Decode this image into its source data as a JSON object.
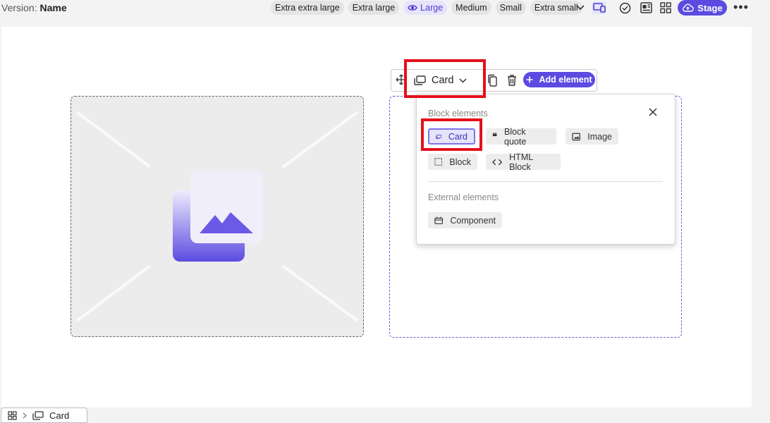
{
  "header": {
    "version_label": "Version:",
    "version_name": "Name",
    "sizes": [
      {
        "label": "Extra extra large",
        "active": false
      },
      {
        "label": "Extra large",
        "active": false
      },
      {
        "label": "Large",
        "active": true
      },
      {
        "label": "Medium",
        "active": false
      },
      {
        "label": "Small",
        "active": false
      },
      {
        "label": "Extra small",
        "active": false
      }
    ],
    "icons": [
      "chevron-down-icon",
      "devices-icon",
      "check-circle-icon",
      "layout-icon",
      "grid-icon"
    ],
    "stage_label": "Stage",
    "more_label": "•••",
    "accent_color": "#5b4be1"
  },
  "toolbar": {
    "element_type": "Card",
    "add_label": "Add element",
    "icons": [
      "move-icon",
      "card-icon",
      "chevron-down-icon",
      "duplicate-icon",
      "trash-icon",
      "plus-icon"
    ]
  },
  "popup": {
    "block_heading": "Block elements",
    "block_items": [
      {
        "label": "Card",
        "icon": "card-icon",
        "active": true
      },
      {
        "label": "Block quote",
        "icon": "quote-icon",
        "active": false
      },
      {
        "label": "Image",
        "icon": "image-icon",
        "active": false
      },
      {
        "label": "Block",
        "icon": "block-icon",
        "active": false
      },
      {
        "label": "HTML Block",
        "icon": "code-icon",
        "active": false
      }
    ],
    "external_heading": "External elements",
    "external_items": [
      {
        "label": "Component",
        "icon": "component-icon"
      }
    ]
  },
  "breadcrumb": {
    "current": "Card"
  },
  "highlight_color": "#e3101a"
}
